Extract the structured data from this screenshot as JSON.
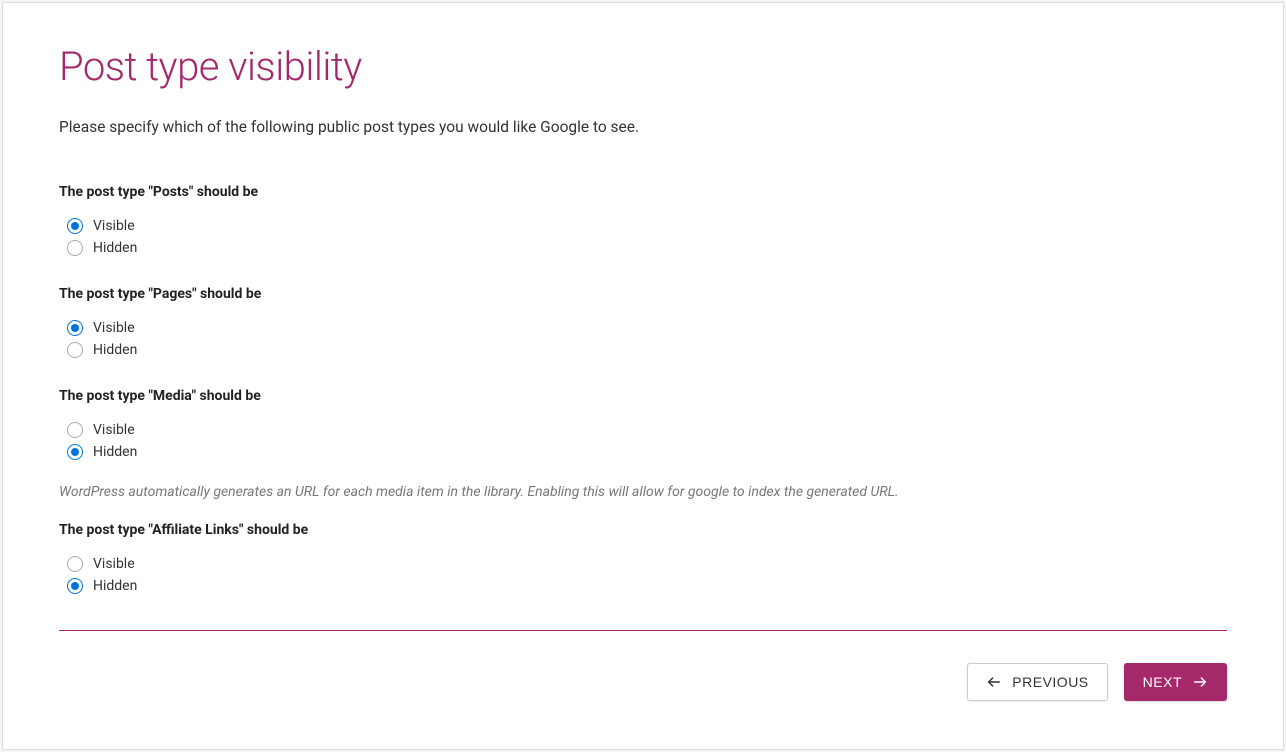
{
  "title": "Post type visibility",
  "intro": "Please specify which of the following public post types you would like Google to see.",
  "options": {
    "visible": "Visible",
    "hidden": "Hidden"
  },
  "sections": [
    {
      "label": "The post type \"Posts\" should be",
      "selected": "visible",
      "help": null
    },
    {
      "label": "The post type \"Pages\" should be",
      "selected": "visible",
      "help": null
    },
    {
      "label": "The post type \"Media\" should be",
      "selected": "hidden",
      "help": "WordPress automatically generates an URL for each media item in the library. Enabling this will allow for google to index the generated URL."
    },
    {
      "label": "The post type \"Affiliate Links\" should be",
      "selected": "hidden",
      "help": null
    }
  ],
  "nav": {
    "previous": "PREVIOUS",
    "next": "NEXT"
  }
}
